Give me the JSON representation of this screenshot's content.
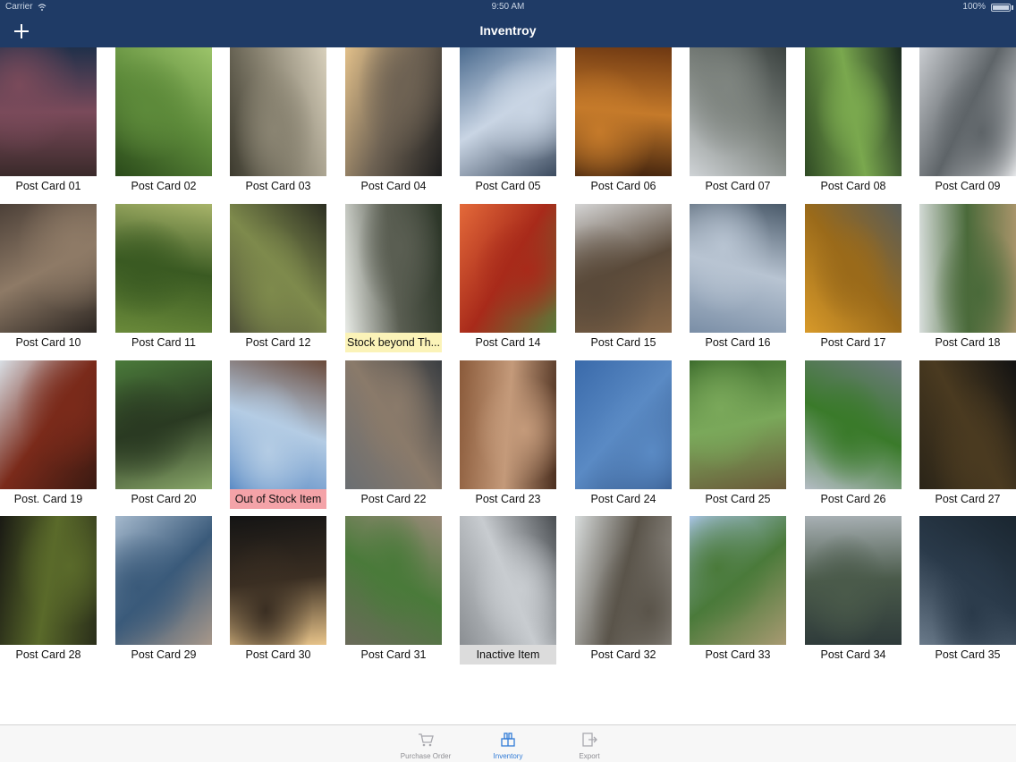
{
  "status_bar": {
    "carrier": "Carrier",
    "time": "9:50 AM",
    "battery": "100%"
  },
  "nav": {
    "title": "Inventroy",
    "add_icon": "plus-icon"
  },
  "colors": {
    "nav": "#1f3b66",
    "warn": "#fbf3b8",
    "out_of_stock": "#f4a3a8",
    "inactive": "#dcdcdc",
    "tab_active": "#2f7ad6"
  },
  "items": [
    {
      "label": "Post Card 01",
      "status": "normal",
      "palette": [
        "#3a2a2a",
        "#7a4a5a",
        "#20304a"
      ]
    },
    {
      "label": "Post Card 02",
      "status": "normal",
      "palette": [
        "#2a4a1a",
        "#5d8a3a",
        "#9cc46a"
      ]
    },
    {
      "label": "Post Card 03",
      "status": "normal",
      "palette": [
        "#3c3a2e",
        "#8a8472",
        "#d8d0bc"
      ]
    },
    {
      "label": "Post Card 04",
      "status": "normal",
      "palette": [
        "#e2c08a",
        "#6e6253",
        "#1e1e1e"
      ]
    },
    {
      "label": "Post Card 05",
      "status": "normal",
      "palette": [
        "#4a6a8e",
        "#c9d5e4",
        "#3b4a5e"
      ]
    },
    {
      "label": "Post Card 06",
      "status": "normal",
      "palette": [
        "#3a1e0c",
        "#c57a2a",
        "#6e3812"
      ]
    },
    {
      "label": "Post Card 07",
      "status": "normal",
      "palette": [
        "#cfd3d6",
        "#7f8580",
        "#3b4240"
      ]
    },
    {
      "label": "Post Card 08",
      "status": "normal",
      "palette": [
        "#2f4a24",
        "#7aa84e",
        "#1b2a1f"
      ]
    },
    {
      "label": "Post Card 09",
      "status": "normal",
      "palette": [
        "#c9ccd0",
        "#5e6468",
        "#ecedef"
      ]
    },
    {
      "label": "Post Card 10",
      "status": "normal",
      "palette": [
        "#4c4038",
        "#8e7a66",
        "#2c2622"
      ]
    },
    {
      "label": "Post Card 11",
      "status": "normal",
      "palette": [
        "#6a8a3a",
        "#3a5a22",
        "#a8b46a"
      ]
    },
    {
      "label": "Post Card 12",
      "status": "normal",
      "palette": [
        "#4e5038",
        "#7e8a4c",
        "#2c2e22"
      ]
    },
    {
      "label": "Stock beyond Th...",
      "status": "warn",
      "palette": [
        "#e8ebe6",
        "#5a5e52",
        "#2a3426"
      ]
    },
    {
      "label": "Post Card 14",
      "status": "normal",
      "palette": [
        "#e46a3a",
        "#a82a1a",
        "#5a7a3a"
      ]
    },
    {
      "label": "Post Card 15",
      "status": "normal",
      "palette": [
        "#d4d4d4",
        "#5a4a3a",
        "#8a6a4a"
      ]
    },
    {
      "label": "Post Card 16",
      "status": "normal",
      "palette": [
        "#7a8ea6",
        "#b8c4d2",
        "#4a5a6a"
      ]
    },
    {
      "label": "Post Card 17",
      "status": "normal",
      "palette": [
        "#d89a2a",
        "#9a6a1a",
        "#5a5e5a"
      ]
    },
    {
      "label": "Post Card 18",
      "status": "normal",
      "palette": [
        "#d8dedc",
        "#4a6a3a",
        "#a8946a"
      ]
    },
    {
      "label": "Post. Card 19",
      "status": "normal",
      "palette": [
        "#d8dee4",
        "#7a2a1a",
        "#3a1a12"
      ]
    },
    {
      "label": "Post Card 20",
      "status": "normal",
      "palette": [
        "#4a7a3a",
        "#2a3a22",
        "#8aa86a"
      ]
    },
    {
      "label": "Out of Stock Item",
      "status": "out",
      "palette": [
        "#5a8ac4",
        "#b4cce4",
        "#6a4a3a"
      ]
    },
    {
      "label": "Post Card 22",
      "status": "normal",
      "palette": [
        "#6a6e72",
        "#8a7a6a",
        "#3a3e42"
      ]
    },
    {
      "label": "Post Card 23",
      "status": "normal",
      "palette": [
        "#8a5a3a",
        "#c49a7a",
        "#4a2e1e"
      ]
    },
    {
      "label": "Post Card 24",
      "status": "normal",
      "palette": [
        "#3a6aaa",
        "#5a8ac4",
        "#2a4a7a"
      ]
    },
    {
      "label": "Post Card 25",
      "status": "normal",
      "palette": [
        "#3a6a2a",
        "#7aa85a",
        "#6a5a3a"
      ]
    },
    {
      "label": "Post Card 26",
      "status": "normal",
      "palette": [
        "#b4bcc4",
        "#3a7a2a",
        "#6e7a80"
      ]
    },
    {
      "label": "Post Card 27",
      "status": "normal",
      "palette": [
        "#2a2418",
        "#4a3a20",
        "#121212"
      ]
    },
    {
      "label": "Post Card 28",
      "status": "normal",
      "palette": [
        "#1a1a14",
        "#5a6a2a",
        "#2a2e1a"
      ]
    },
    {
      "label": "Post Card 29",
      "status": "normal",
      "palette": [
        "#a4b8cc",
        "#3a5a7a",
        "#a8988a"
      ]
    },
    {
      "label": "Post Card 30",
      "status": "normal",
      "palette": [
        "#141414",
        "#3a2e22",
        "#e8c48a"
      ]
    },
    {
      "label": "Post Card 31",
      "status": "normal",
      "palette": [
        "#6a6a5a",
        "#4a7a3a",
        "#9a8a7a"
      ]
    },
    {
      "label": "Inactive Item",
      "status": "inactive",
      "palette": [
        "#8a8e92",
        "#c8ccd0",
        "#4a4e52"
      ]
    },
    {
      "label": "Post Card 32",
      "status": "normal",
      "palette": [
        "#d8dcdc",
        "#5a544a",
        "#9a9690"
      ]
    },
    {
      "label": "Post Card 33",
      "status": "normal",
      "palette": [
        "#a8c4e4",
        "#4a7a3a",
        "#a89a72"
      ]
    },
    {
      "label": "Post Card 34",
      "status": "normal",
      "palette": [
        "#a8b0b4",
        "#4a5a4a",
        "#2e3a3a"
      ]
    },
    {
      "label": "Post Card 35",
      "status": "normal",
      "palette": [
        "#6a7a8a",
        "#2a3a4a",
        "#1a2630"
      ]
    }
  ],
  "tabs": [
    {
      "label": "Purchase Order",
      "icon": "cart-icon",
      "active": false
    },
    {
      "label": "Inventory",
      "icon": "inventory-icon",
      "active": true
    },
    {
      "label": "Export",
      "icon": "export-icon",
      "active": false
    }
  ]
}
